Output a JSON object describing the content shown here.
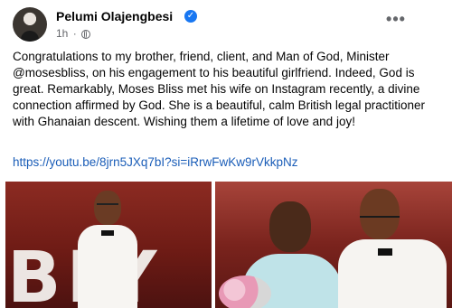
{
  "post": {
    "author": "Pelumi Olajengbesi",
    "time": "1h",
    "separator": "·",
    "more_label": "•••",
    "text": "Congratulations to my brother, friend, client, and Man of God, Minister @mosesbliss, on his engagement to his beautiful girlfriend. Indeed, God is great. Remarkably, Moses Bliss met his wife on Instagram recently, a divine connection affirmed by God. She is a beautiful, calm British legal practitioner with Ghanaian descent. Wishing them a lifetime of love and joy!",
    "link": "https://youtu.be/8jrn5JXq7bI?si=iRrwFwKw9rVkkpNz",
    "verified_mark": "✓"
  },
  "colors": {
    "link": "#1a5db8",
    "verified": "#1877f2",
    "meta": "#65676b"
  },
  "photos": [
    {
      "name": "photo-left-on-stage",
      "letters": "BLY"
    },
    {
      "name": "photo-right-couple"
    }
  ]
}
